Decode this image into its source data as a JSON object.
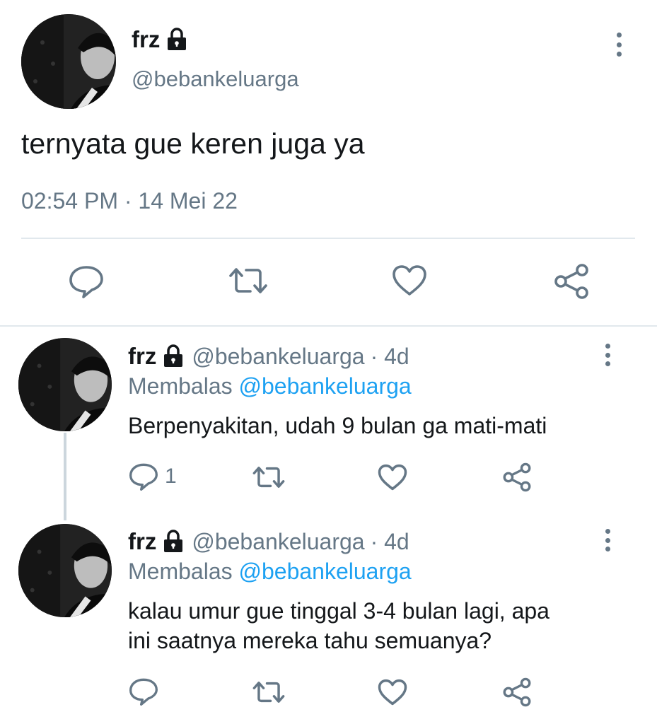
{
  "main_tweet": {
    "display_name": "frz",
    "handle": "@bebankeluarga",
    "text": "ternyata gue keren juga ya",
    "timestamp": "02:54 PM · 14 Mei 22"
  },
  "replies": [
    {
      "display_name": "frz",
      "handle": "@bebankeluarga",
      "time": "· 4d",
      "replying_prefix": "Membalas",
      "replying_to": "@bebankeluarga",
      "text_line1": "Berpenyakitan, udah 9 bulan ga mati-mati",
      "reply_count": "1"
    },
    {
      "display_name": "frz",
      "handle": "@bebankeluarga",
      "time": "· 4d",
      "replying_prefix": "Membalas",
      "replying_to": "@bebankeluarga",
      "text_line1": "kalau umur gue tinggal 3-4 bulan lagi, apa",
      "text_line2": "ini saatnya mereka tahu semuanya?"
    }
  ],
  "icons": {
    "reply": "reply-icon",
    "retweet": "retweet-icon",
    "like": "heart-icon",
    "share": "share-icon",
    "lock": "lock-icon",
    "more": "more-vertical-icon"
  },
  "colors": {
    "text": "#14171a",
    "muted": "#657786",
    "link": "#1da1f2",
    "divider": "#e1e8ed"
  }
}
